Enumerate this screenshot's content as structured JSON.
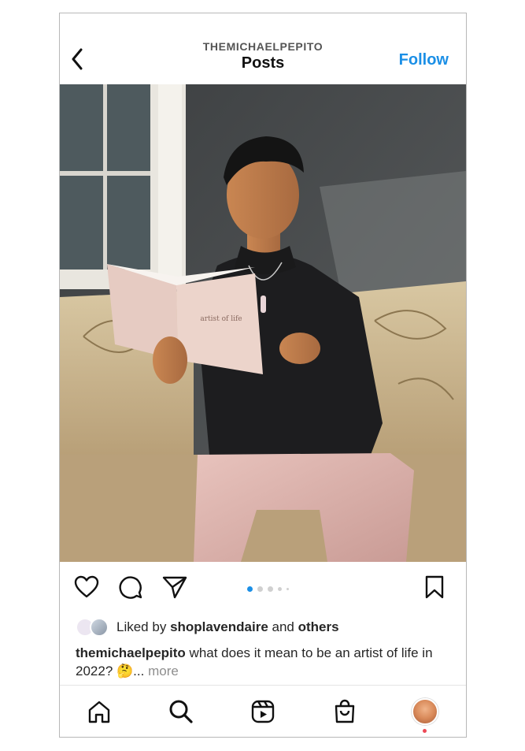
{
  "header": {
    "username": "THEMICHAELPEPITO",
    "title": "Posts",
    "follow_label": "Follow"
  },
  "post": {
    "book_title": "artist of life",
    "carousel": {
      "count": 5,
      "active_index": 0
    },
    "likes": {
      "prefix": "Liked by ",
      "liked_by": "shoplavendaire",
      "middle": " and ",
      "others": "others"
    },
    "caption": {
      "username": "themichaelpepito",
      "text": " what does it mean to be an artist of life in 2022? 🤔",
      "ellipsis": "... ",
      "more": "more"
    }
  },
  "colors": {
    "accent": "#1b8fe6",
    "notification": "#ed4956",
    "muted_text": "#8e8e8e"
  },
  "icons": {
    "back": "chevron-left-icon",
    "like": "heart-icon",
    "comment": "comment-icon",
    "share": "paper-plane-icon",
    "save": "bookmark-icon",
    "home": "home-icon",
    "search": "search-icon",
    "reels": "reels-icon",
    "shop": "shop-bag-icon",
    "profile": "profile-avatar"
  }
}
